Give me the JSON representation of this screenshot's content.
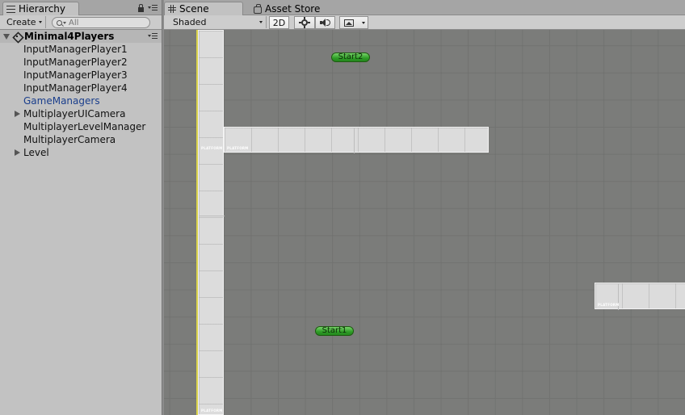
{
  "hierarchy": {
    "tab_label": "Hierarchy",
    "create_label": "Create",
    "search_placeholder": "All",
    "scene_name": "Minimal4Players",
    "items": [
      {
        "label": "InputManagerPlayer1",
        "expandable": false
      },
      {
        "label": "InputManagerPlayer2",
        "expandable": false
      },
      {
        "label": "InputManagerPlayer3",
        "expandable": false
      },
      {
        "label": "InputManagerPlayer4",
        "expandable": false
      },
      {
        "label": "GameManagers",
        "expandable": false,
        "color": "#1a3e8c"
      },
      {
        "label": "MultiplayerUICamera",
        "expandable": true
      },
      {
        "label": "MultiplayerLevelManager",
        "expandable": false
      },
      {
        "label": "MultiplayerCamera",
        "expandable": false
      },
      {
        "label": "Level",
        "expandable": true
      }
    ]
  },
  "scene": {
    "tab_scene": "Scene",
    "tab_asset_store": "Asset Store",
    "shading_mode": "Shaded",
    "mode_2d_label": "2D",
    "icons": [
      "sun-icon",
      "speaker-icon",
      "image-icon"
    ],
    "labels": {
      "start1": "Start1",
      "start2": "Start2",
      "platform": "PLATFORM"
    },
    "colors": {
      "viewport": "#7b7c7a",
      "start_marker": "#2e9d26",
      "axis": "#d9d24a"
    }
  }
}
